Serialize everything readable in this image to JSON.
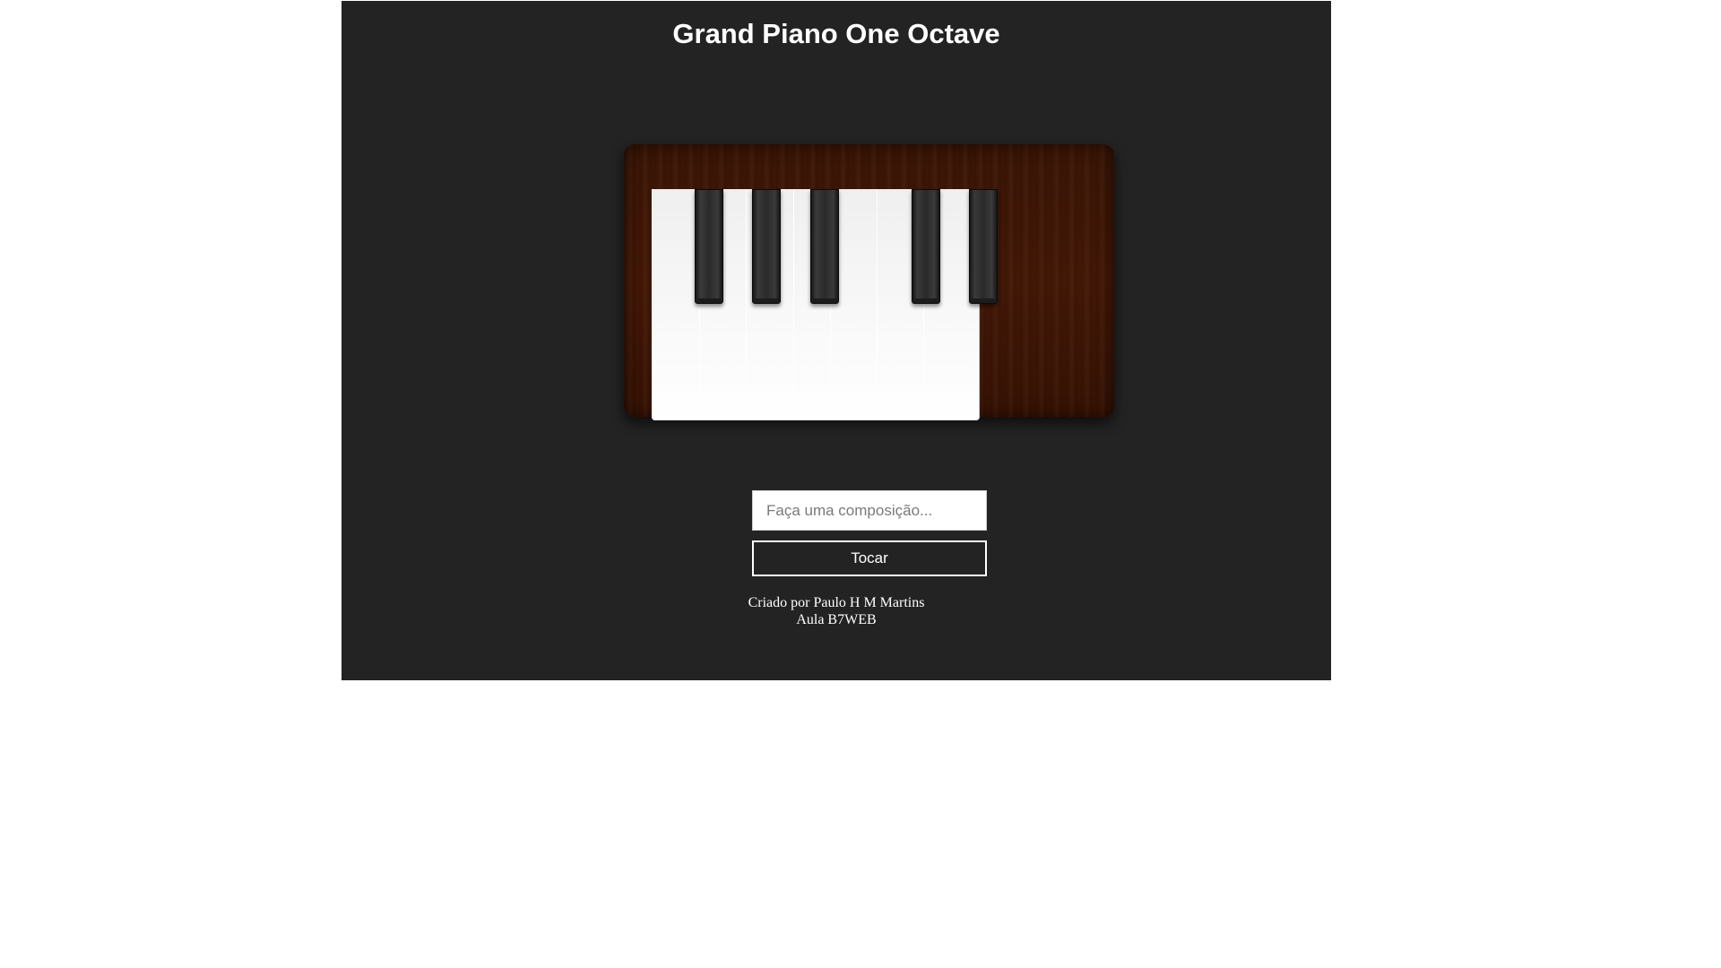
{
  "header": {
    "title": "Grand Piano One Octave"
  },
  "piano": {
    "white_keys": [
      "C",
      "D",
      "E",
      "F",
      "G",
      "A",
      "B"
    ],
    "black_keys": [
      "C#",
      "D#",
      "F#",
      "G#",
      "A#"
    ],
    "colors": {
      "case": "#441806",
      "background": "#232323"
    }
  },
  "composer": {
    "input_value": "",
    "input_placeholder": "Faça uma composição...",
    "play_label": "Tocar"
  },
  "footer": {
    "author_line": "Criado por Paulo H M Martins",
    "course_line": "Aula B7WEB"
  }
}
